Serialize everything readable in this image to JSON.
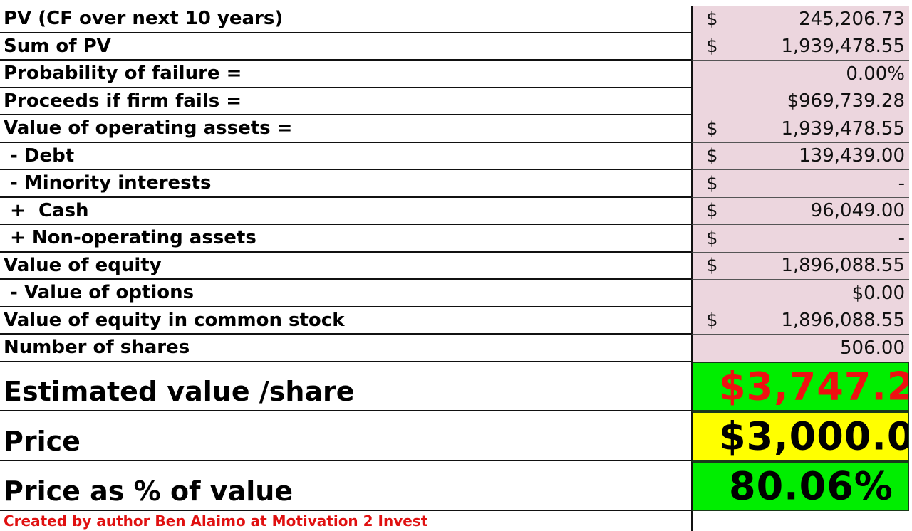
{
  "rows": [
    {
      "label": "PV (CF over next 10 years)",
      "currency": "$",
      "value": "245,206.73"
    },
    {
      "label": "Sum of PV",
      "currency": "$",
      "value": "1,939,478.55"
    },
    {
      "label": "Probability of failure =",
      "currency": "",
      "value": "0.00%"
    },
    {
      "label": "Proceeds if firm fails =",
      "currency": "",
      "value": "$969,739.28"
    },
    {
      "label": "Value of operating assets =",
      "currency": "$",
      "value": "1,939,478.55"
    },
    {
      "label": " - Debt",
      "currency": "$",
      "value": "139,439.00"
    },
    {
      "label": " - Minority interests",
      "currency": "$",
      "value": "-"
    },
    {
      "label": " +  Cash",
      "currency": "$",
      "value": "96,049.00"
    },
    {
      "label": " + Non-operating assets",
      "currency": "$",
      "value": "-"
    },
    {
      "label": "Value of equity",
      "currency": "$",
      "value": "1,896,088.55"
    },
    {
      "label": " - Value of options",
      "currency": "",
      "value": "$0.00"
    },
    {
      "label": "Value of equity in common stock",
      "currency": "$",
      "value": "1,896,088.55"
    },
    {
      "label": "Number of shares",
      "currency": "",
      "value": "506.00"
    }
  ],
  "summary": [
    {
      "label": "Estimated value /share",
      "value": "$3,747.2",
      "bg": "#00ee00",
      "color": "#ee1111"
    },
    {
      "label": "Price",
      "value": "$3,000.0",
      "bg": "#ffff00",
      "color": "#000000"
    },
    {
      "label": "Price as % of value",
      "value": "80.06%",
      "bg": "#00ee00",
      "color": "#000000"
    }
  ],
  "footer": "Created by author Ben Alaimo at Motivation 2 Invest"
}
